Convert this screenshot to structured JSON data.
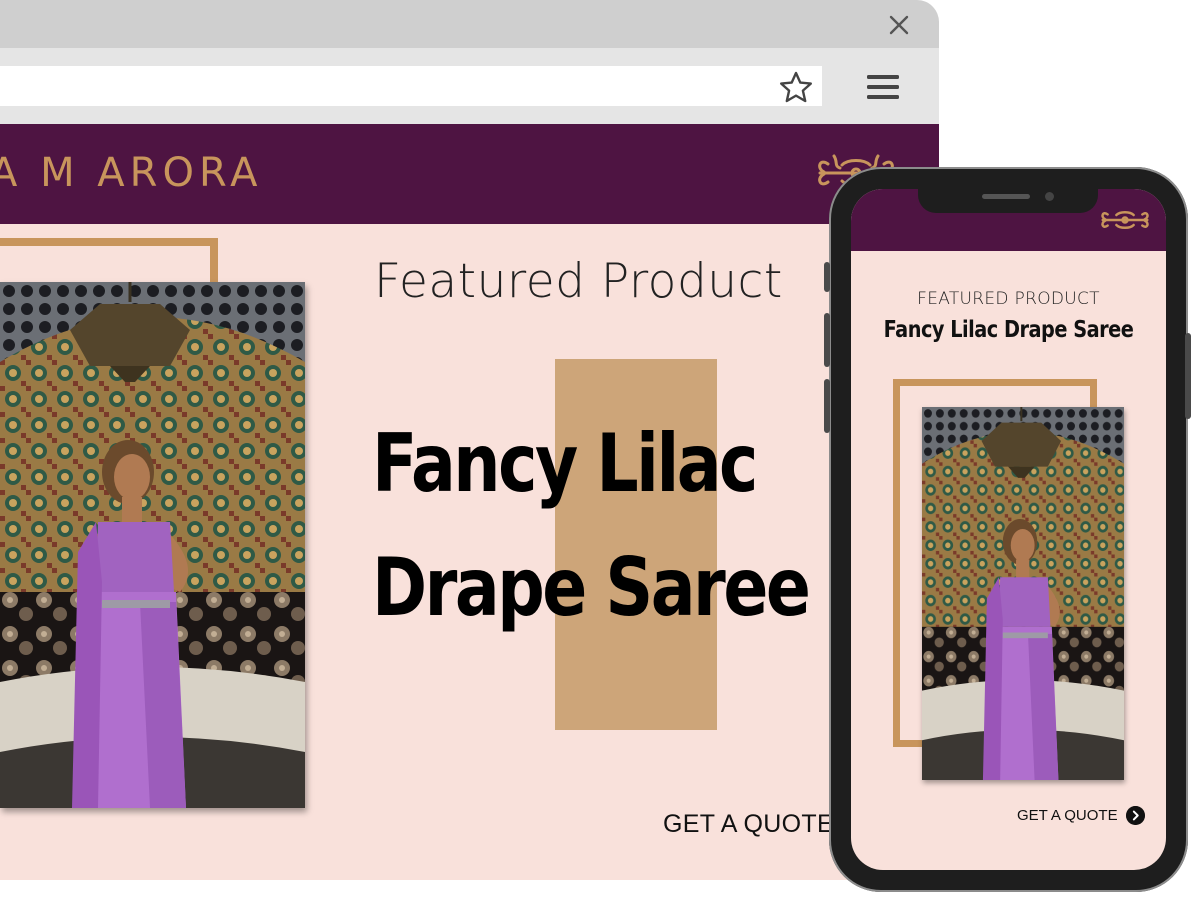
{
  "browser": {
    "close_icon": "close-icon",
    "star_icon": "star-outline-icon",
    "menu_icon": "hamburger-menu-icon"
  },
  "site": {
    "brand": "A M ARORA",
    "ornament_icon": "decorative-scroll-ornament-icon",
    "featured_label": "Featured Product",
    "product_name_line1": "Fancy Lilac",
    "product_name_line2": "Drape Saree",
    "cta_label": "GET A QUOTE",
    "cta_icon": "chevron-right-circle-icon"
  },
  "mobile": {
    "featured_label": "FEATURED PRODUCT",
    "product_name": "Fancy Lilac Drape Saree",
    "cta_label": "GET A QUOTE"
  },
  "colors": {
    "header_plum": "#4e1442",
    "gold": "#c8955c",
    "accent_tan": "#cda579",
    "page_blush": "#f9e1db"
  }
}
